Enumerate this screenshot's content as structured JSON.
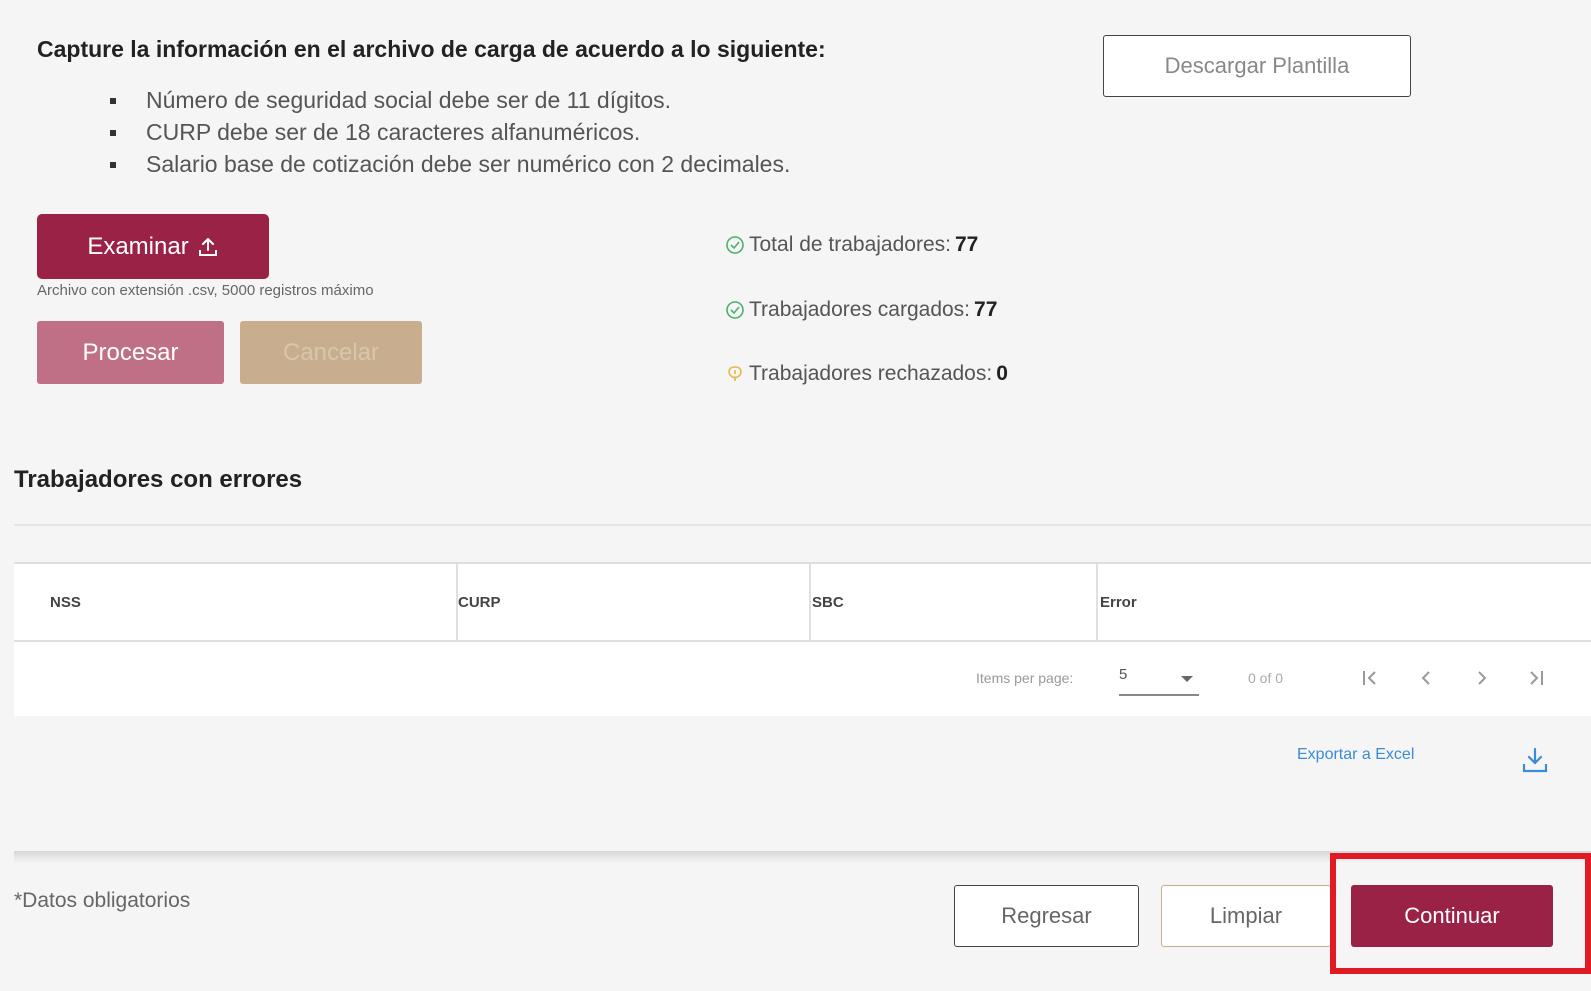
{
  "instructions": {
    "heading": "Capture la información en el archivo de carga de acuerdo a lo siguiente:",
    "rules": [
      "Número de seguridad social debe ser de 11 dígitos.",
      "CURP debe ser de 18 caracteres alfanuméricos.",
      "Salario base de cotización debe ser numérico con 2 decimales."
    ]
  },
  "template_button": "Descargar Plantilla",
  "upload": {
    "examinar_label": "Examinar",
    "hint": "Archivo con extensión .csv, 5000 registros máximo",
    "procesar_label": "Procesar",
    "cancelar_label": "Cancelar"
  },
  "stats": [
    {
      "label": "Total de trabajadores:",
      "value": "77",
      "icon": "check-circle-icon",
      "color": "#4caf6e"
    },
    {
      "label": "Trabajadores cargados:",
      "value": "77",
      "icon": "check-circle-icon",
      "color": "#4caf6e"
    },
    {
      "label": "Trabajadores rechazados:",
      "value": "0",
      "icon": "warning-shield-icon",
      "color": "#e8b84a"
    }
  ],
  "errors_section": {
    "title": "Trabajadores con errores",
    "columns": [
      "NSS",
      "CURP",
      "SBC",
      "Error"
    ],
    "rows": [],
    "paginator": {
      "items_per_page_label": "Items per page:",
      "items_per_page_value": "5",
      "range_label": "0 of 0"
    },
    "export_label": "Exportar a Excel"
  },
  "footer": {
    "required_note": "*Datos obligatorios",
    "regresar_label": "Regresar",
    "limpiar_label": "Limpiar",
    "continuar_label": "Continuar"
  },
  "colors": {
    "primary": "#9b2247",
    "primary_light": "#bf6f86",
    "tan": "#c8ae8e",
    "link": "#3b8bd6",
    "highlight": "#e01b24"
  }
}
